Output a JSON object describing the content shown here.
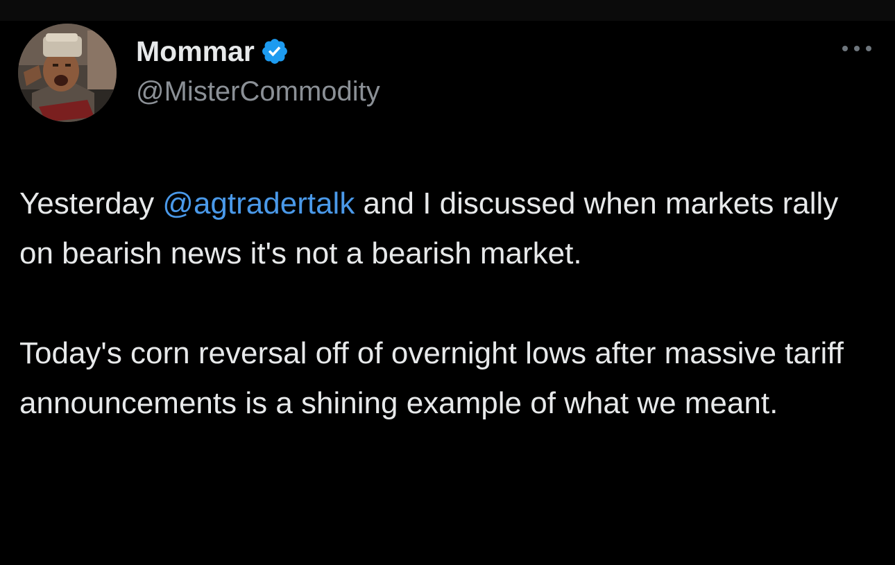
{
  "author": {
    "display_name": "Mommar",
    "handle": "@MisterCommodity",
    "verified_icon": "verified-badge-icon",
    "avatar": "avatar-photo"
  },
  "more_icon": "more-options-icon",
  "tweet": {
    "para1_before": "Yesterday ",
    "mention": "@agtradertalk",
    "para1_after": " and I discussed when markets rally on bearish news it's not a bearish market.",
    "para2": "Today's corn reversal off of overnight lows after massive tariff announcements is a shining example of what we meant."
  },
  "colors": {
    "background": "#000000",
    "text": "#e7e9ea",
    "secondary_text": "#8b9096",
    "link": "#4a99e9",
    "verified": "#1d9bf0"
  }
}
